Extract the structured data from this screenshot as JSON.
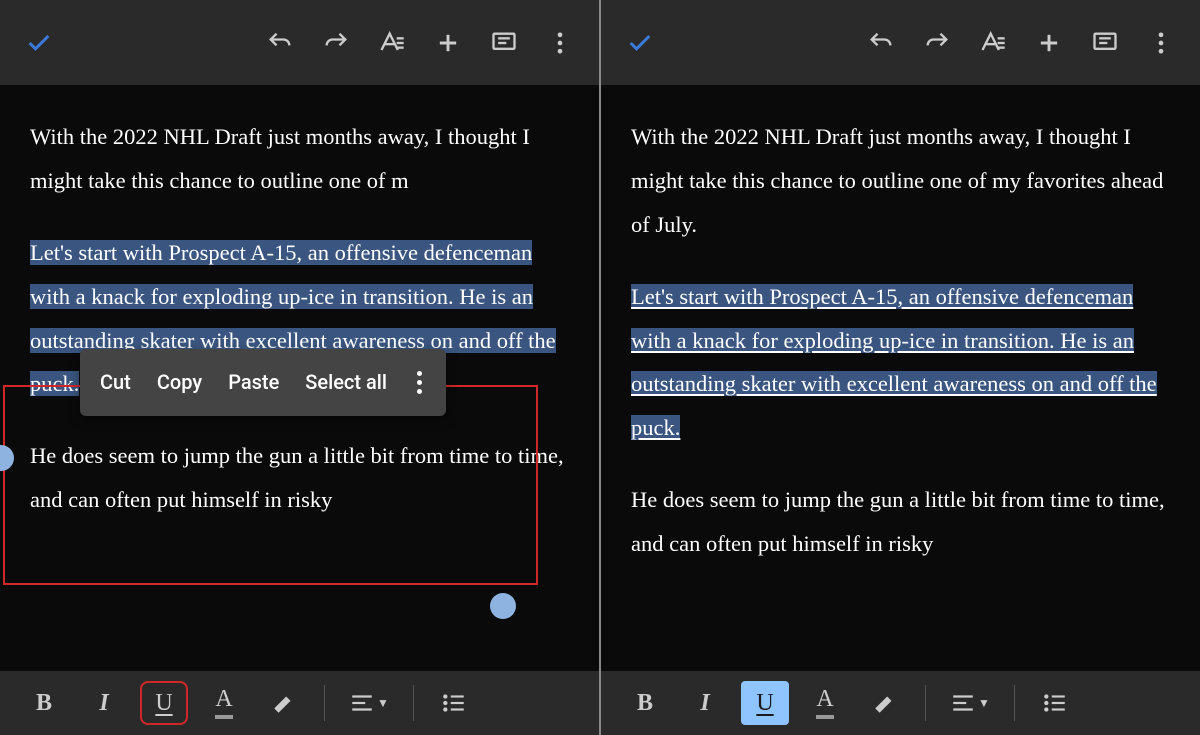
{
  "left": {
    "para1": "With the 2022 NHL Draft just months away, I thought I might take this chance to outline one of m",
    "para1_rest": "",
    "para2": "Let's start with Prospect A-15, an offensive defenceman with a knack for exploding up-ice in transition. He is an outstanding skater with excellent awareness on and off the puck.",
    "para3": "He does seem to jump the gun a little bit from time to time, and can often put himself in risky",
    "contextMenu": {
      "cut": "Cut",
      "copy": "Copy",
      "paste": "Paste",
      "selectAll": "Select all"
    }
  },
  "right": {
    "para1": "With the 2022 NHL Draft just months away, I thought I might take this chance to outline one of my favorites ahead of July.",
    "para2": "Let's start with Prospect A-15, an offensive defenceman with a knack for exploding up-ice in transition. He is an outstanding skater with excellent awareness on and off the puck.",
    "para3": "He does seem to jump the gun a little bit from time to time, and can often put himself in risky"
  },
  "format": {
    "bold": "B",
    "italic": "I",
    "underline": "U",
    "textcolor": "A"
  }
}
